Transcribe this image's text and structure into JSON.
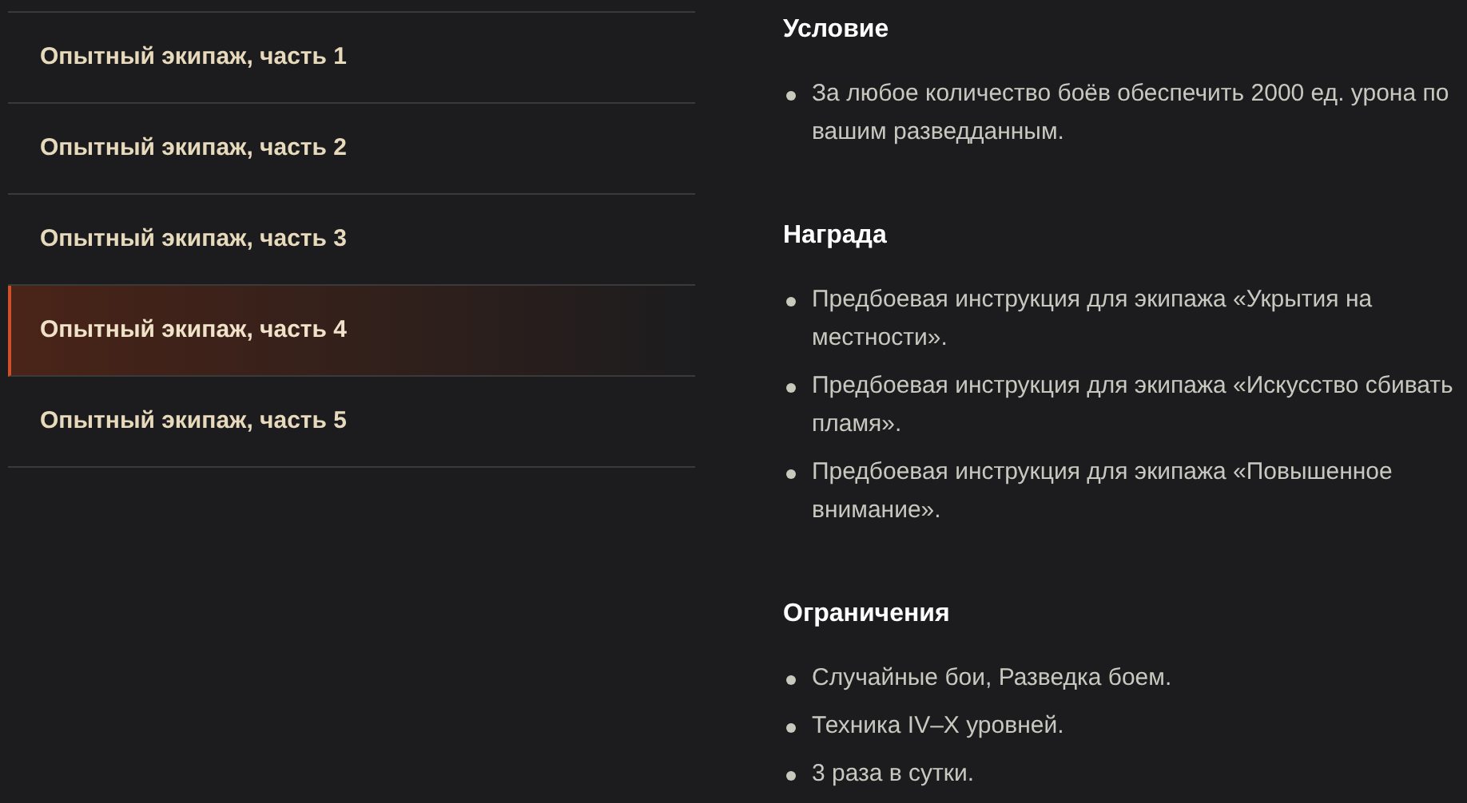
{
  "missions": [
    {
      "label": "Опытный экипаж, часть 1",
      "selected": false
    },
    {
      "label": "Опытный экипаж, часть 2",
      "selected": false
    },
    {
      "label": "Опытный экипаж, часть 3",
      "selected": false
    },
    {
      "label": "Опытный экипаж, часть 4",
      "selected": true
    },
    {
      "label": "Опытный экипаж, часть 5",
      "selected": false
    }
  ],
  "sections": [
    {
      "title": "Условие",
      "items": [
        "За любое количество боёв обеспечить 2000 ед. урона по вашим разведданным."
      ]
    },
    {
      "title": "Награда",
      "items": [
        "Предбоевая инструкция для экипажа «Укрытия на местности».",
        "Предбоевая инструкция для экипажа «Искусство сбивать пламя».",
        "Предбоевая инструкция для экипажа «Повышенное внимание»."
      ]
    },
    {
      "title": "Ограничения",
      "items": [
        "Случайные бои, Разведка боем.",
        "Техника IV–X уровней.",
        "3 раза в сутки."
      ]
    }
  ]
}
